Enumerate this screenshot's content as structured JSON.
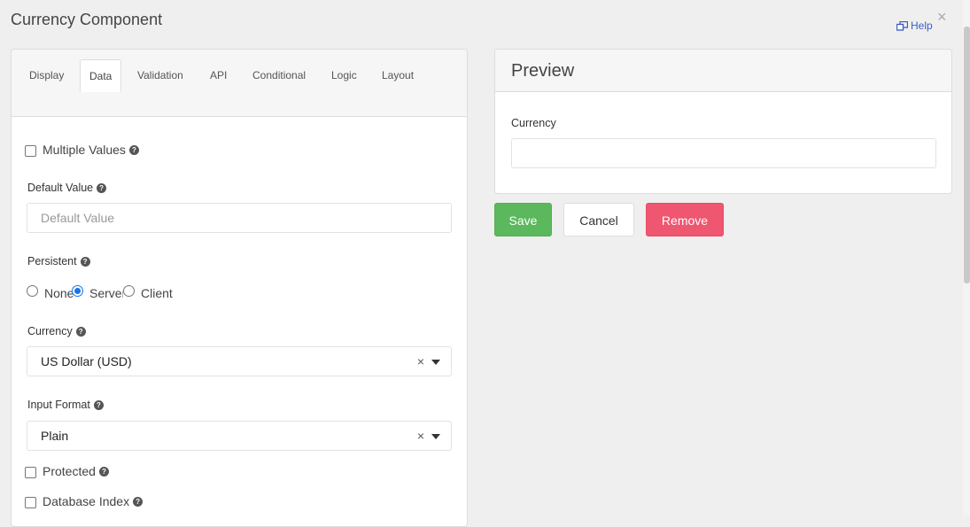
{
  "dialog": {
    "title": "Currency Component",
    "help_label": "Help",
    "close_glyph": "×"
  },
  "tabs": [
    {
      "label": "Display"
    },
    {
      "label": "Data"
    },
    {
      "label": "Validation"
    },
    {
      "label": "API"
    },
    {
      "label": "Conditional"
    },
    {
      "label": "Logic"
    },
    {
      "label": "Layout"
    }
  ],
  "active_tab": "Data",
  "form": {
    "multiple_values": {
      "label": "Multiple Values",
      "checked": false
    },
    "default_value": {
      "label": "Default Value",
      "placeholder": "Default Value",
      "value": ""
    },
    "persistent": {
      "label": "Persistent",
      "options": [
        {
          "label": "None",
          "checked": false
        },
        {
          "label": "Server",
          "checked": true
        },
        {
          "label": "Client",
          "checked": false
        }
      ]
    },
    "currency": {
      "label": "Currency",
      "value": "US Dollar (USD)"
    },
    "input_format": {
      "label": "Input Format",
      "value": "Plain"
    },
    "protected": {
      "label": "Protected",
      "checked": false
    },
    "database_index": {
      "label": "Database Index",
      "checked": false
    }
  },
  "preview": {
    "title": "Preview",
    "field_label": "Currency",
    "field_value": ""
  },
  "buttons": {
    "save": "Save",
    "cancel": "Cancel",
    "remove": "Remove"
  },
  "colors": {
    "save": "#5cb85c",
    "remove": "#ef5670",
    "link": "#3b5dc9",
    "radio_checked": "#1a73e8"
  },
  "icons": {
    "help": "external-window-icon",
    "close": "close-icon",
    "tooltip": "question-circle-icon",
    "dropdown": "caret-down-icon",
    "clear": "clear-x-icon"
  }
}
